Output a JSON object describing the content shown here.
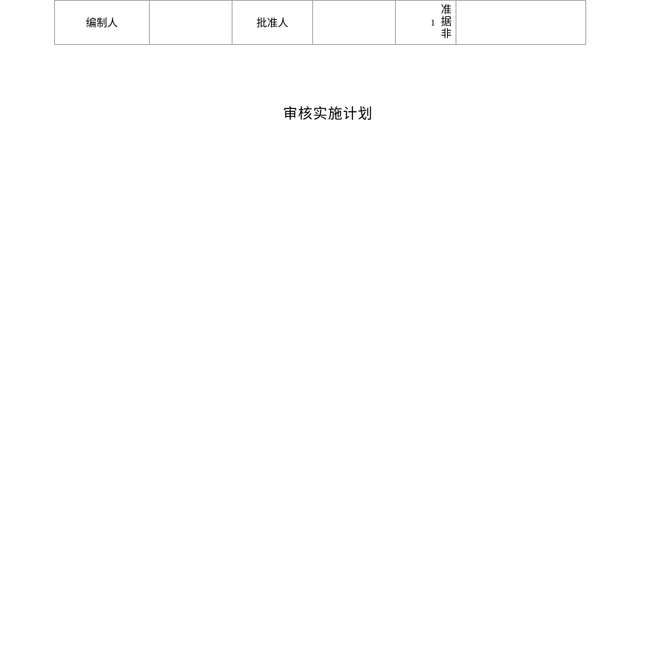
{
  "signatureRow": {
    "preparerLabel": "编制人",
    "preparerValue": "",
    "approverLabel": "批准人",
    "approverValue": "",
    "pageIndicator": "1",
    "verticalChars": {
      "c1": "准",
      "c2": "据",
      "c3": "非"
    },
    "lastCell": ""
  },
  "sectionTitle": "审核实施计划"
}
